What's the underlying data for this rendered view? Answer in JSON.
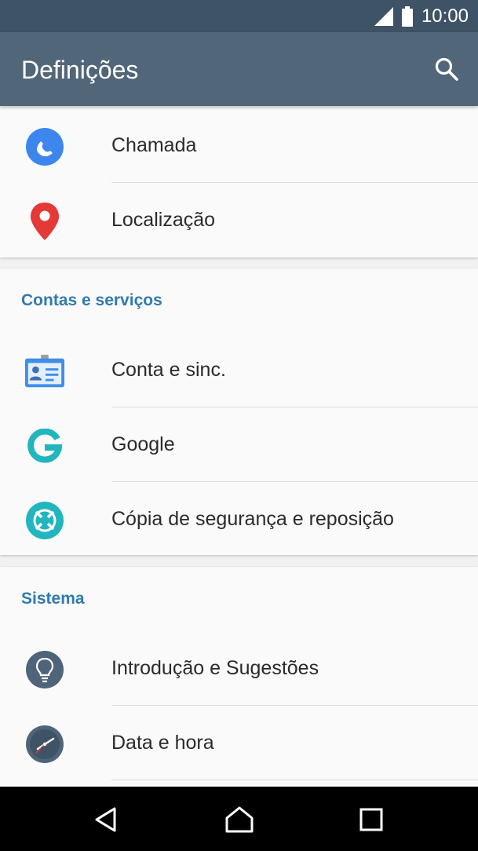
{
  "status_bar": {
    "time": "10:00"
  },
  "app_bar": {
    "title": "Definições"
  },
  "sections": [
    {
      "header": "",
      "items": [
        {
          "label": "Chamada",
          "icon": "phone-icon"
        },
        {
          "label": "Localização",
          "icon": "location-pin-icon"
        }
      ]
    },
    {
      "header": "Contas e serviços",
      "items": [
        {
          "label": "Conta e sinc.",
          "icon": "account-card-icon"
        },
        {
          "label": "Google",
          "icon": "google-icon"
        },
        {
          "label": "Cópia de segurança e reposição",
          "icon": "backup-icon"
        }
      ]
    },
    {
      "header": "Sistema",
      "items": [
        {
          "label": "Introdução e Sugestões",
          "icon": "lightbulb-icon"
        },
        {
          "label": "Data e hora",
          "icon": "clock-icon"
        }
      ]
    }
  ],
  "colors": {
    "status_bar": "#3f5366",
    "app_bar": "#516679",
    "section_header": "#2f7ab0",
    "background": "#f1f1f1",
    "card": "#fafafa"
  }
}
